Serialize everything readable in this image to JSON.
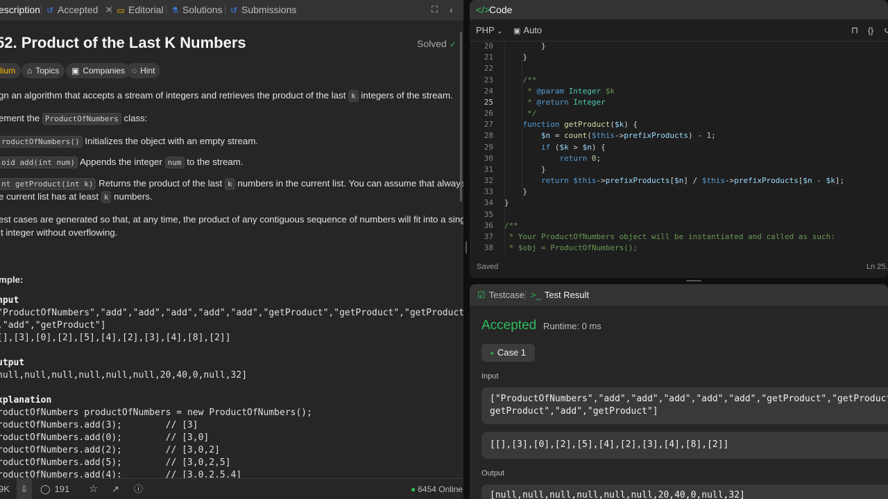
{
  "left_tabs": {
    "description": "escription",
    "accepted": "Accepted",
    "editorial": "Editorial",
    "solutions": "Solutions",
    "submissions": "Submissions"
  },
  "problem": {
    "title": "52. Product of the Last K Numbers",
    "solved_label": "Solved",
    "difficulty": "lium",
    "tags": [
      "Topics",
      "Companies",
      "Hint"
    ],
    "para1_pre": "gn an algorithm that accepts a stream of integers and retrieves the product of the last",
    "para1_code": "k",
    "para1_post": "integers of the stream.",
    "para2_pre": "ement the",
    "para2_code": "ProductOfNumbers",
    "para2_post": "class:",
    "bullet1_code": "roductOfNumbers()",
    "bullet1_text": "Initializes the object with an empty stream.",
    "bullet2_code": "oid add(int num)",
    "bullet2_mid": "Appends the integer",
    "bullet2_code2": "num",
    "bullet2_post": "to the stream.",
    "bullet3_code": "nt getProduct(int k)",
    "bullet3_mid": "Returns the product of the last",
    "bullet3_code2": "k",
    "bullet3_post": "numbers in the current list. You can assume that always",
    "bullet3_line2_pre": "e current list has at least",
    "bullet3_line2_code": "k",
    "bullet3_line2_post": "numbers.",
    "note_line1": "est cases are generated so that, at any time, the product of any contiguous sequence of numbers will fit into a single",
    "note_line2": "it integer without overflowing."
  },
  "example": {
    "heading": "mple:",
    "input_label": "nput",
    "input_line1": "\"ProductOfNumbers\",\"add\",\"add\",\"add\",\"add\",\"add\",\"getProduct\",\"getProduct\",\"getProduct",
    "input_line2": ",\"add\",\"getProduct\"]",
    "input_line3": "[],[3],[0],[2],[5],[4],[2],[3],[4],[8],[2]]",
    "output_label": "utput",
    "output_line": "null,null,null,null,null,null,20,40,0,null,32]",
    "explanation_label": "xplanation",
    "explanation_lines": [
      "roductOfNumbers productOfNumbers = new ProductOfNumbers();",
      "roductOfNumbers.add(3);        // [3]",
      "roductOfNumbers.add(0);        // [3,0]",
      "roductOfNumbers.add(2);        // [3,0,2]",
      "roductOfNumbers.add(5);        // [3,0,2,5]",
      "roductOfNumbers.add(4):        // [3.0.2.5.4]"
    ]
  },
  "left_bottom": {
    "likes": "9K",
    "comments": "191",
    "online": "6454 Online"
  },
  "code_panel": {
    "title": "Code",
    "language": "PHP",
    "mode": "Auto",
    "status_saved": "Saved",
    "status_pos": "Ln 25,",
    "active_line": "25",
    "line_numbers": [
      "20",
      "21",
      "22",
      "23",
      "24",
      "25",
      "26",
      "27",
      "28",
      "29",
      "30",
      "31",
      "32",
      "33",
      "34",
      "35",
      "36",
      "37",
      "38"
    ]
  },
  "test_panel": {
    "tab_testcase": "Testcase",
    "tab_result": "Test Result",
    "verdict": "Accepted",
    "runtime": "Runtime: 0 ms",
    "case_label": "Case 1",
    "input_label": "Input",
    "input_line1": "[\"ProductOfNumbers\",\"add\",\"add\",\"add\",\"add\",\"add\",\"getProduct\",\"getProduct\",\"",
    "input_line2": "getProduct\",\"add\",\"getProduct\"]",
    "input_args": "[[],[3],[0],[2],[5],[4],[2],[3],[4],[8],[2]]",
    "output_label": "Output",
    "output_line": "[null,null,null,null,null,null,20,40,0,null,32]"
  },
  "colors": {
    "accent_green": "#2cbb5d",
    "difficulty_yellow": "#ffb800",
    "link_blue": "#3b82f6"
  }
}
